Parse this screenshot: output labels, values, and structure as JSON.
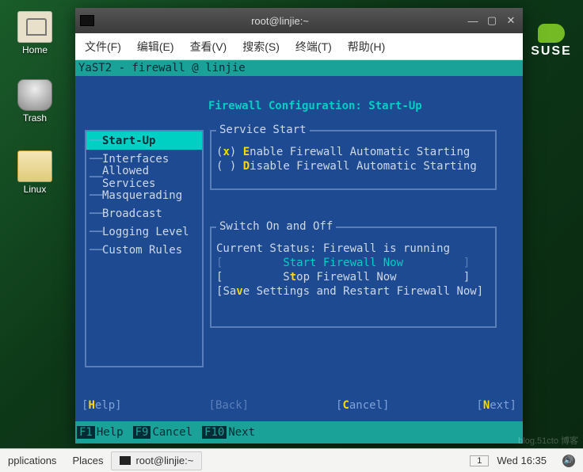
{
  "desktop": {
    "home": "Home",
    "trash": "Trash",
    "linux": "Linux"
  },
  "brand": "SUSE",
  "window": {
    "title": "root@linjie:~",
    "menus": [
      {
        "label": "文件(F)"
      },
      {
        "label": "编辑(E)"
      },
      {
        "label": "查看(V)"
      },
      {
        "label": "搜索(S)"
      },
      {
        "label": "终端(T)"
      },
      {
        "label": "帮助(H)"
      }
    ]
  },
  "yast": {
    "header": "YaST2 - firewall @ linjie",
    "title": "Firewall Configuration: Start-Up",
    "sidebar": [
      {
        "label": "Start-Up",
        "selected": true
      },
      {
        "label": "Interfaces",
        "selected": false
      },
      {
        "label": "Allowed Services",
        "selected": false
      },
      {
        "label": "Masquerading",
        "selected": false
      },
      {
        "label": "Broadcast",
        "selected": false
      },
      {
        "label": "Logging Level",
        "selected": false
      },
      {
        "label": "Custom Rules",
        "selected": false
      }
    ],
    "service_start": {
      "legend": "Service Start",
      "opt_enable": {
        "mark": "x",
        "hk": "E",
        "rest": "nable Firewall Automatic Starting"
      },
      "opt_disable": {
        "mark": " ",
        "hk": "D",
        "rest": "isable Firewall Automatic Starting"
      }
    },
    "switch": {
      "legend": "Switch On and Off",
      "status": "Current Status: Firewall is running",
      "start_btn": "Start Firewall Now",
      "stop_btn": {
        "pre": "S",
        "hk": "t",
        "post": "op Firewall Now"
      },
      "save_btn": {
        "pre": "Sa",
        "hk": "v",
        "post": "e Settings and Restart Firewall Now"
      }
    },
    "bottom": {
      "help": {
        "hk": "H",
        "rest": "elp"
      },
      "back": "[Back]",
      "cancel": {
        "hk": "C",
        "rest": "ancel"
      },
      "next": {
        "hk": "N",
        "rest": "ext"
      }
    },
    "fkeys": {
      "f1": "F1",
      "f1l": "Help",
      "f9": "F9",
      "f9l": "Cancel",
      "f10": "F10",
      "f10l": "Next"
    }
  },
  "taskbar": {
    "applications": "pplications",
    "places": "Places",
    "task_title": "root@linjie:~",
    "workspace": "1",
    "clock": "Wed 16:35"
  },
  "watermark": "blog.51cto 博客"
}
